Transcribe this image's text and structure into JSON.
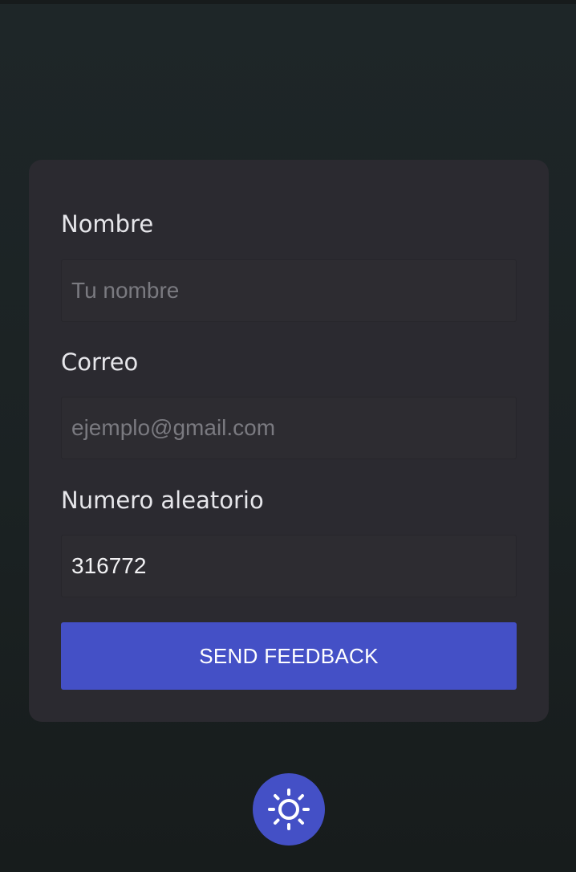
{
  "form": {
    "name": {
      "label": "Nombre",
      "value": "",
      "placeholder": "Tu nombre"
    },
    "email": {
      "label": "Correo",
      "value": "",
      "placeholder": "ejemplo@gmail.com"
    },
    "random_number": {
      "label": "Numero aleatorio",
      "value": "316772",
      "placeholder": ""
    },
    "submit_label": "SEND FEEDBACK"
  },
  "theme_toggle": {
    "icon": "sun-icon"
  },
  "colors": {
    "accent": "#4450c6",
    "card": "#2b2a30",
    "background": "#1e2628"
  }
}
